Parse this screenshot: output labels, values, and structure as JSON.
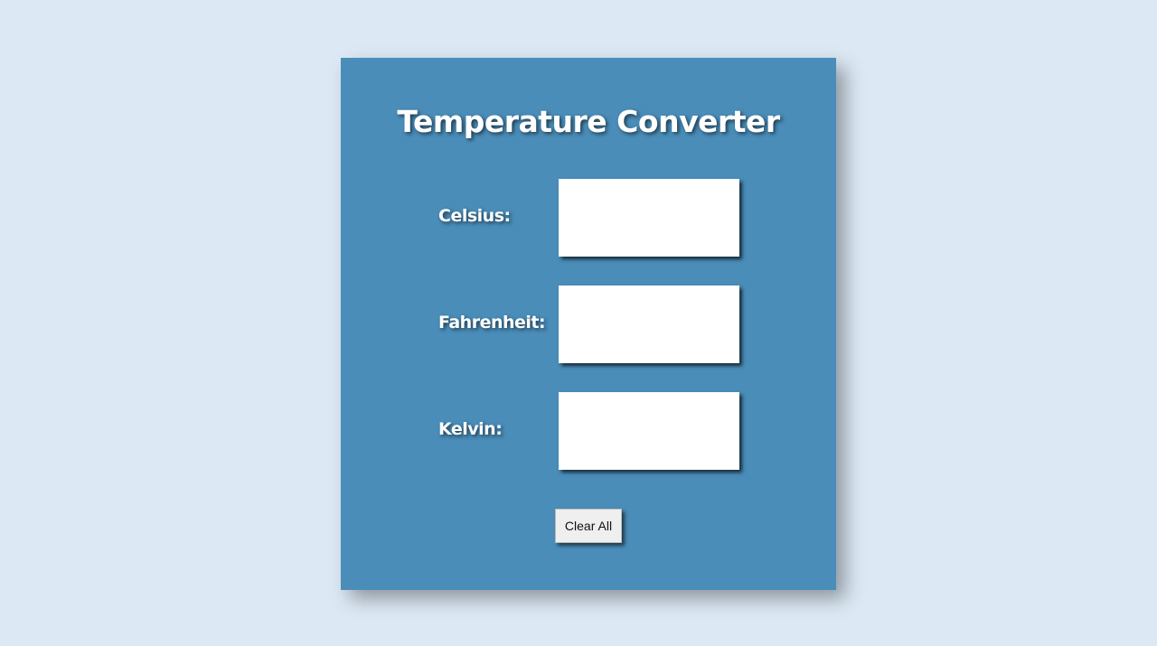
{
  "title": "Temperature Converter",
  "fields": {
    "celsius": {
      "label": "Celsius:",
      "value": "",
      "placeholder": ""
    },
    "fahrenheit": {
      "label": "Fahrenheit:",
      "value": "",
      "placeholder": ""
    },
    "kelvin": {
      "label": "Kelvin:",
      "value": "",
      "placeholder": ""
    }
  },
  "actions": {
    "clear_label": "Clear All"
  },
  "colors": {
    "background": "#dce9f5",
    "card": "#4a8db9",
    "field": "#ffffff",
    "button": "#efefef"
  }
}
